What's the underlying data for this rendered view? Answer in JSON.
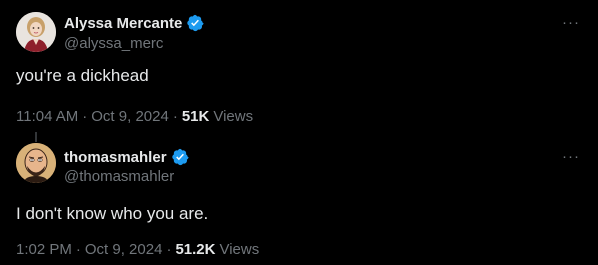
{
  "tweets": [
    {
      "display_name": "Alyssa Mercante",
      "handle": "@alyssa_merc",
      "more": "···",
      "text": "you're a dickhead",
      "time": "11:04 AM",
      "date": "Oct 9, 2024",
      "separator": "·",
      "views_count": "51K",
      "views_label": "Views",
      "verified_icon": "verified-badge-icon",
      "avatar_icon": "avatar-woman"
    },
    {
      "display_name": "thomasmahler",
      "handle": "@thomasmahler",
      "more": "···",
      "text": "I don't know who you are.",
      "time": "1:02 PM",
      "date": "Oct 9, 2024",
      "separator": "·",
      "views_count": "51.2K",
      "views_label": "Views",
      "verified_icon": "verified-badge-icon",
      "avatar_icon": "avatar-bald-man"
    }
  ],
  "colors": {
    "background": "#000000",
    "primary_text": "#e7e9ea",
    "secondary_text": "#71767b",
    "verified_blue": "#1d9bf0"
  }
}
